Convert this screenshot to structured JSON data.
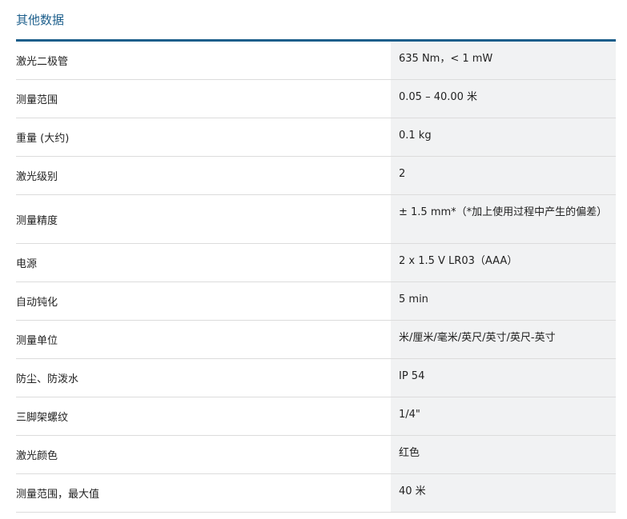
{
  "section": {
    "title": "其他数据"
  },
  "specs": [
    {
      "label": "激光二极管",
      "value": "635 Nm，< 1 mW"
    },
    {
      "label": "测量范围",
      "value": "0.05 – 40.00 米"
    },
    {
      "label": "重量 (大约)",
      "value": "0.1 kg"
    },
    {
      "label": "激光级别",
      "value": "2"
    },
    {
      "label": "测量精度",
      "value": "± 1.5 mm*（*加上使用过程中产生的偏差）"
    },
    {
      "label": "电源",
      "value": "2 x 1.5 V LR03（AAA）"
    },
    {
      "label": "自动钝化",
      "value": "5 min"
    },
    {
      "label": "测量单位",
      "value": "米/厘米/毫米/英尺/英寸/英尺-英寸"
    },
    {
      "label": "防尘、防泼水",
      "value": "IP 54"
    },
    {
      "label": "三脚架螺纹",
      "value": "1/4\""
    },
    {
      "label": "激光颜色",
      "value": "红色"
    },
    {
      "label": "测量范围，最大值",
      "value": "40 米"
    }
  ]
}
